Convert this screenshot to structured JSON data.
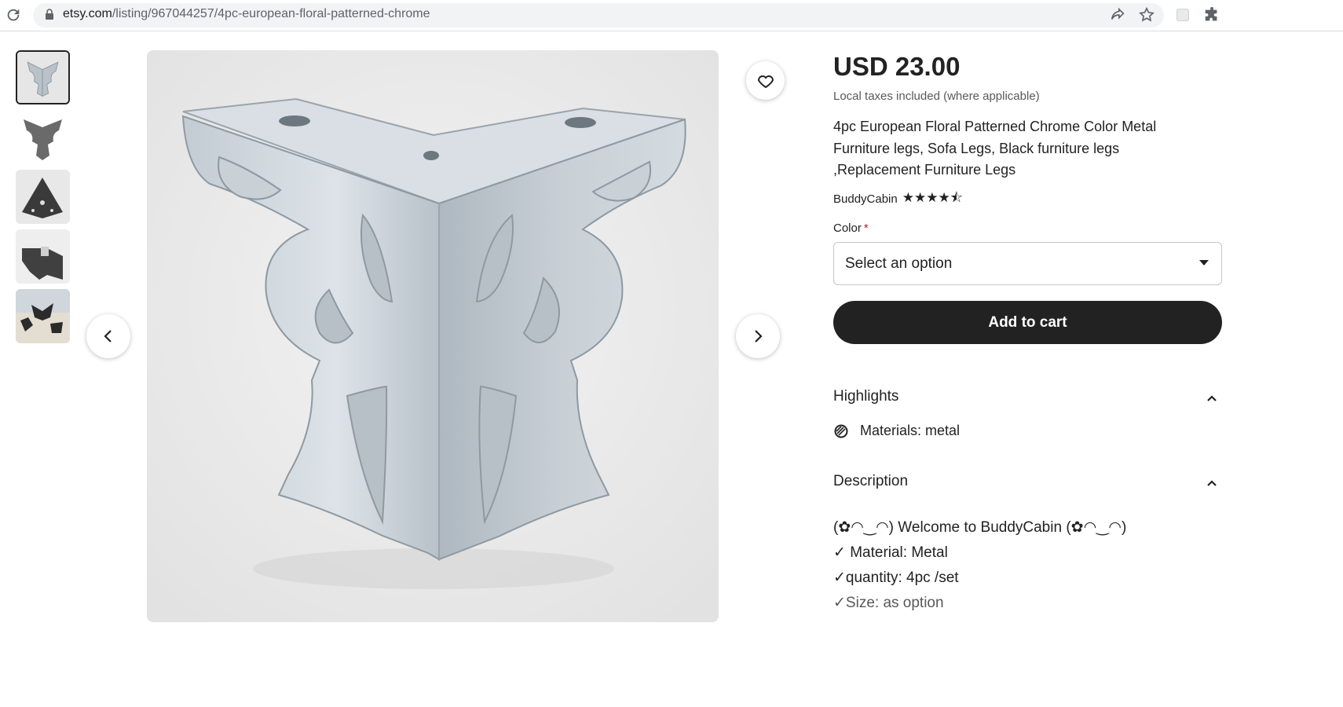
{
  "browser": {
    "url_host": "etsy.com",
    "url_path": "/listing/967044257/4pc-european-floral-patterned-chrome",
    "icons": [
      "reload-icon",
      "lock-icon",
      "share-icon",
      "bookmark-star-icon",
      "extension-icon",
      "puzzle-icon"
    ]
  },
  "gallery": {
    "thumbnails": [
      "thumbnail-1",
      "thumbnail-2",
      "thumbnail-3",
      "thumbnail-4",
      "thumbnail-5"
    ],
    "active_index": 0,
    "icons": [
      "chevron-left-icon",
      "chevron-right-icon",
      "heart-icon"
    ]
  },
  "listing": {
    "price": "USD 23.00",
    "tax_note": "Local taxes included (where applicable)",
    "title": "4pc European Floral Patterned Chrome Color Metal Furniture legs, Sofa Legs, Black furniture legs ,Replacement Furniture Legs",
    "shop_name": "BuddyCabin",
    "rating": 4.5,
    "rating_stars": "★★★★⯪",
    "color_label": "Color",
    "required_marker": "*",
    "select_placeholder": "Select an option",
    "add_to_cart": "Add to cart"
  },
  "highlights": {
    "heading": "Highlights",
    "items": [
      "Materials: metal"
    ]
  },
  "description": {
    "heading": "Description",
    "lines": [
      "(✿◠‿◠) Welcome to BuddyCabin (✿◠‿◠)",
      "✓ Material: Metal",
      "✓quantity: 4pc /set",
      "✓Size: as option"
    ]
  },
  "colors": {
    "primary_text": "#222222",
    "button_dark": "#222222",
    "required_red": "#b2203a",
    "muted_text": "#595959"
  }
}
